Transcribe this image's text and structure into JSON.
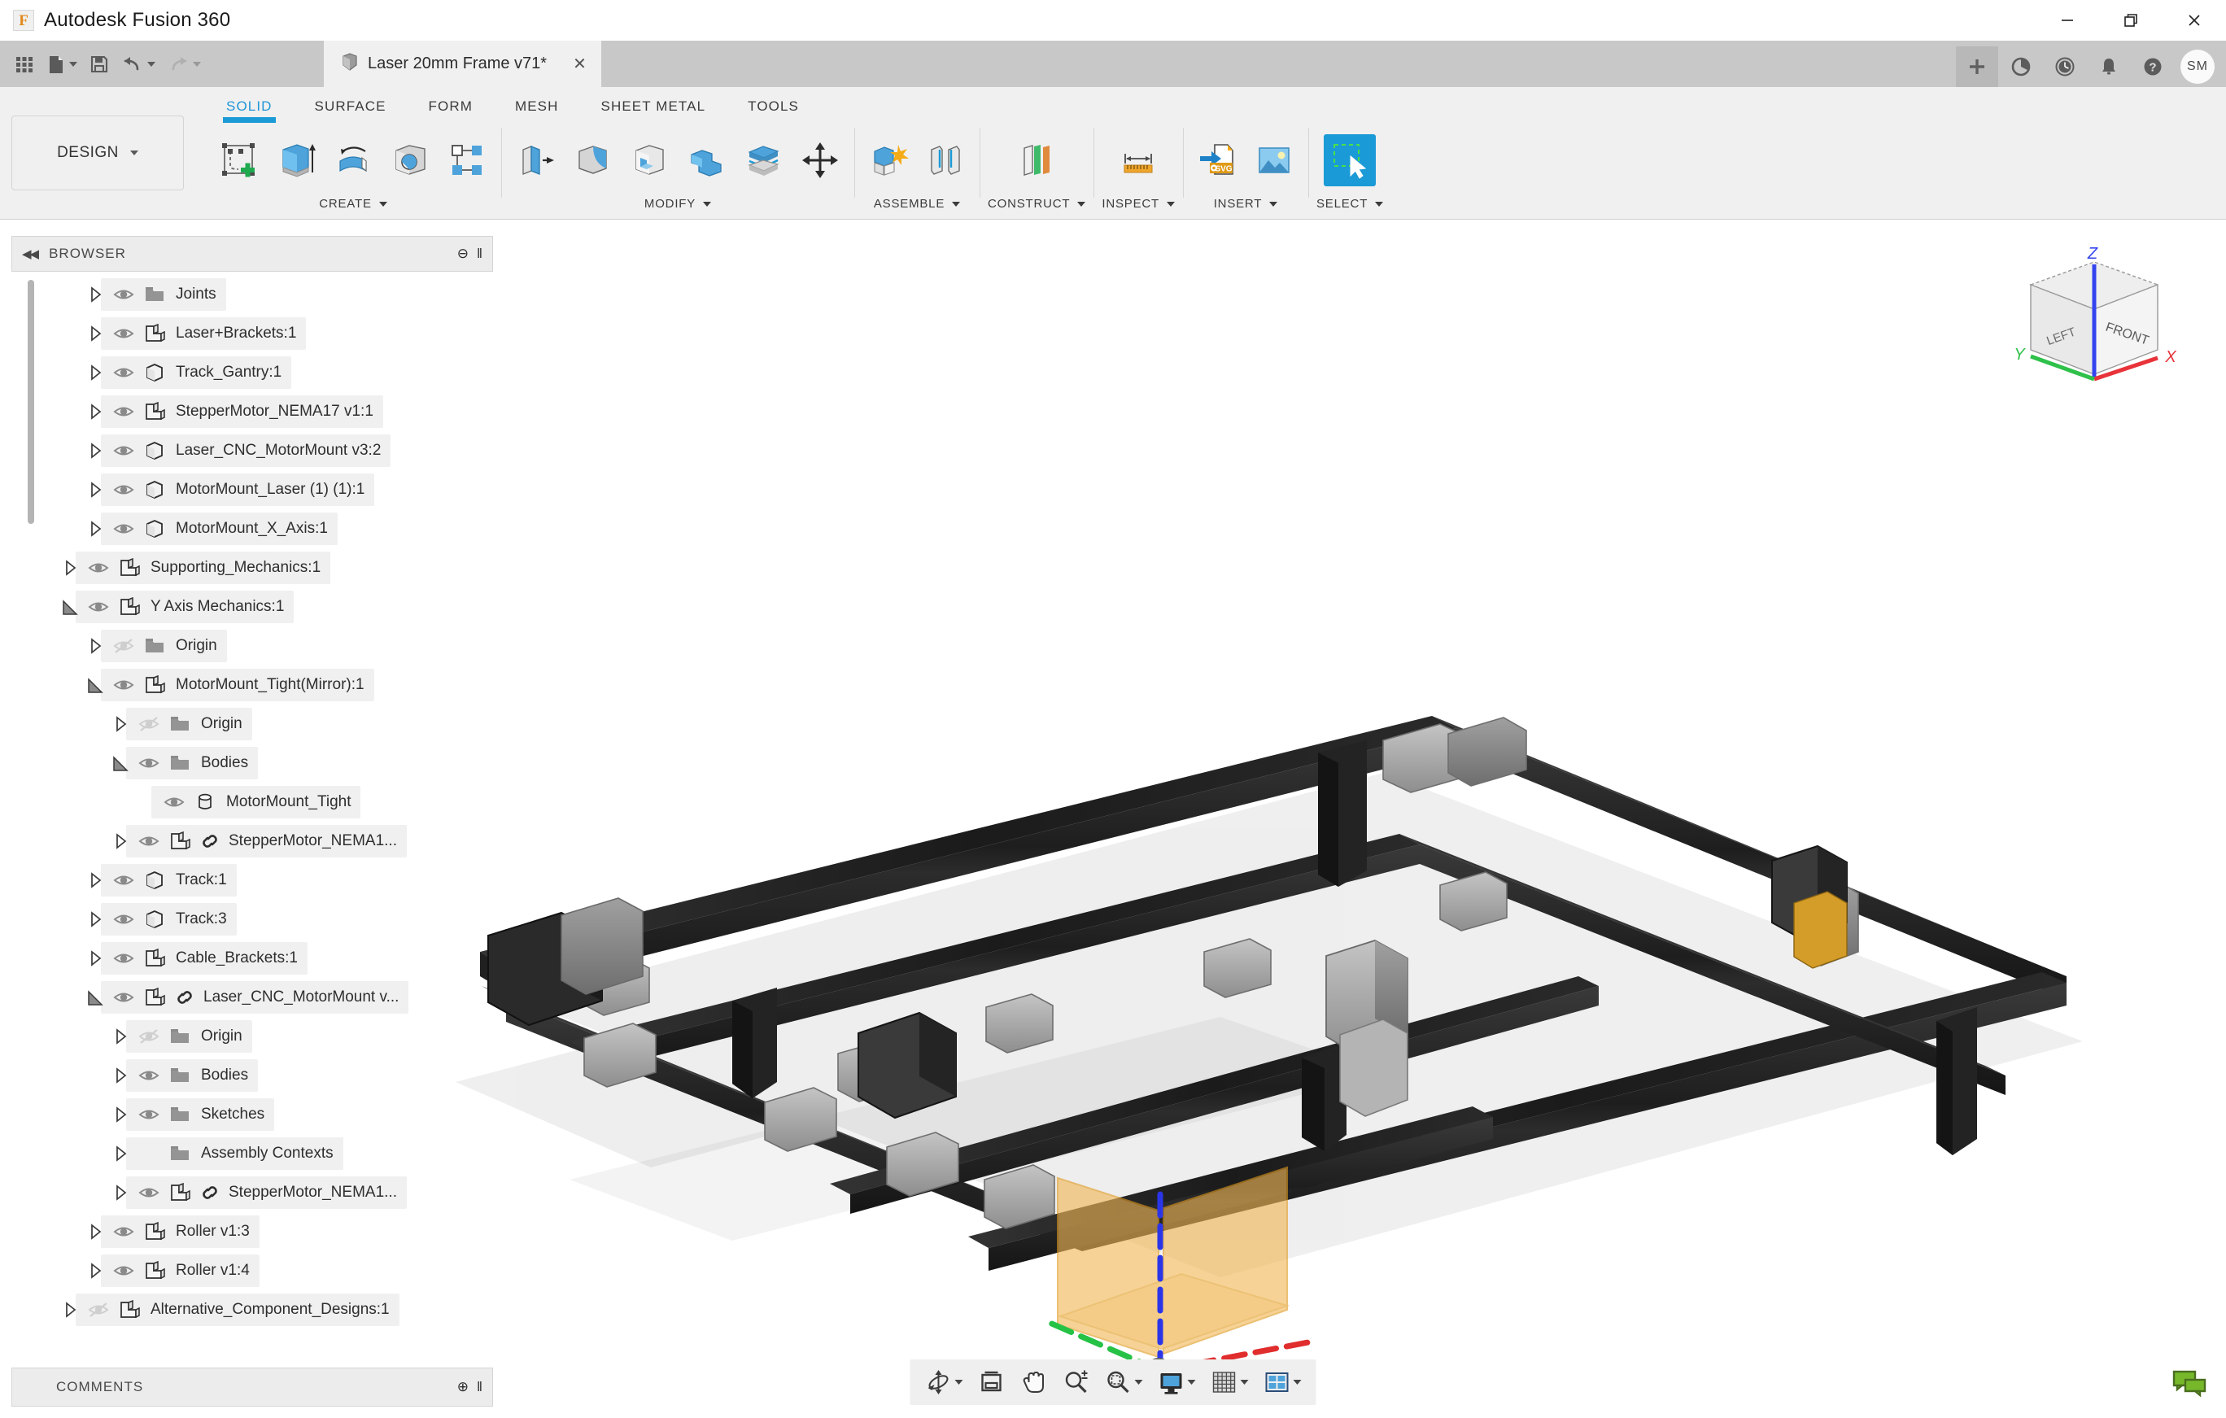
{
  "window": {
    "app_title": "Autodesk Fusion 360",
    "logo_glyph": "F",
    "minimize": "—",
    "restore": "❐",
    "close": "✕"
  },
  "quick_access": {
    "items": [
      {
        "name": "app-grid-icon",
        "label": "Grid"
      },
      {
        "name": "new-file-icon",
        "label": "New",
        "caret": true
      },
      {
        "name": "save-icon",
        "label": "Save"
      },
      {
        "name": "undo-icon",
        "label": "Undo",
        "caret": true
      },
      {
        "name": "redo-icon",
        "label": "Redo",
        "caret": true
      }
    ]
  },
  "document_tab": {
    "title": "Laser 20mm Frame v71*",
    "close_glyph": "✕",
    "icon": "component-icon"
  },
  "tab_actions": [
    {
      "name": "new-tab-button",
      "glyph": "+",
      "active": true
    },
    {
      "name": "extensions-icon",
      "glyph": "◔"
    },
    {
      "name": "recent-clock-icon",
      "glyph": "◴"
    },
    {
      "name": "notifications-bell-icon",
      "glyph": "▲"
    },
    {
      "name": "help-icon",
      "glyph": "?"
    }
  ],
  "user": {
    "initials": "SM"
  },
  "workspace": {
    "label": "DESIGN"
  },
  "ribbon": {
    "tabs": [
      {
        "label": "SOLID",
        "active": true
      },
      {
        "label": "SURFACE",
        "active": false
      },
      {
        "label": "FORM",
        "active": false
      },
      {
        "label": "MESH",
        "active": false
      },
      {
        "label": "SHEET METAL",
        "active": false
      },
      {
        "label": "TOOLS",
        "active": false
      }
    ],
    "groups": [
      {
        "label": "CREATE",
        "caret": true,
        "tools": [
          {
            "name": "create-sketch-icon"
          },
          {
            "name": "extrude-icon"
          },
          {
            "name": "revolve-icon"
          },
          {
            "name": "hole-icon"
          },
          {
            "name": "pattern-icon"
          }
        ]
      },
      {
        "label": "MODIFY",
        "caret": true,
        "tools": [
          {
            "name": "press-pull-icon"
          },
          {
            "name": "fillet-icon"
          },
          {
            "name": "shell-icon"
          },
          {
            "name": "combine-icon"
          },
          {
            "name": "offset-face-icon"
          },
          {
            "name": "move-copy-icon"
          }
        ]
      },
      {
        "label": "ASSEMBLE",
        "caret": true,
        "tools": [
          {
            "name": "new-component-icon"
          },
          {
            "name": "joint-icon"
          }
        ]
      },
      {
        "label": "CONSTRUCT",
        "caret": true,
        "tools": [
          {
            "name": "offset-plane-icon"
          }
        ]
      },
      {
        "label": "INSPECT",
        "caret": true,
        "tools": [
          {
            "name": "measure-icon"
          }
        ]
      },
      {
        "label": "INSERT",
        "caret": true,
        "tools": [
          {
            "name": "insert-svg-icon"
          },
          {
            "name": "insert-image-icon"
          }
        ]
      },
      {
        "label": "SELECT",
        "caret": true,
        "tools": [
          {
            "name": "select-window-icon",
            "selected": true
          }
        ]
      }
    ]
  },
  "browser": {
    "title": "BROWSER",
    "collapse_glyph": "◀◀",
    "settings_glyph": "⊖",
    "grip_glyph": "‖",
    "tree": [
      {
        "label": "Joints",
        "indent": 2,
        "arrow": "collapsed",
        "eye": "visible",
        "icon": "folder-icon",
        "link": false
      },
      {
        "label": "Laser+Brackets:1",
        "indent": 2,
        "arrow": "collapsed",
        "eye": "visible",
        "icon": "component-icon",
        "link": false
      },
      {
        "label": "Track_Gantry:1",
        "indent": 2,
        "arrow": "collapsed",
        "eye": "visible",
        "icon": "body-icon",
        "link": false
      },
      {
        "label": "StepperMotor_NEMA17 v1:1",
        "indent": 2,
        "arrow": "collapsed",
        "eye": "visible",
        "icon": "component-icon",
        "link": false
      },
      {
        "label": "Laser_CNC_MotorMount v3:2",
        "indent": 2,
        "arrow": "collapsed",
        "eye": "visible",
        "icon": "body-icon",
        "link": false
      },
      {
        "label": "MotorMount_Laser (1) (1):1",
        "indent": 2,
        "arrow": "collapsed",
        "eye": "visible",
        "icon": "body-icon",
        "link": false
      },
      {
        "label": "MotorMount_X_Axis:1",
        "indent": 2,
        "arrow": "collapsed",
        "eye": "visible",
        "icon": "body-icon",
        "link": false
      },
      {
        "label": "Supporting_Mechanics:1",
        "indent": 1,
        "arrow": "collapsed",
        "eye": "visible",
        "icon": "component-icon",
        "link": false
      },
      {
        "label": "Y Axis Mechanics:1",
        "indent": 1,
        "arrow": "expanded",
        "eye": "visible",
        "icon": "component-icon",
        "link": false
      },
      {
        "label": "Origin",
        "indent": 2,
        "arrow": "collapsed",
        "eye": "hidden",
        "icon": "folder-icon",
        "link": false
      },
      {
        "label": "MotorMount_Tight(Mirror):1",
        "indent": 2,
        "arrow": "expanded",
        "eye": "visible",
        "icon": "component-icon",
        "link": false
      },
      {
        "label": "Origin",
        "indent": 3,
        "arrow": "collapsed",
        "eye": "hidden",
        "icon": "folder-icon",
        "link": false
      },
      {
        "label": "Bodies",
        "indent": 3,
        "arrow": "expanded",
        "eye": "visible",
        "icon": "folder-icon",
        "link": false
      },
      {
        "label": "MotorMount_Tight",
        "indent": 4,
        "arrow": "none",
        "eye": "visible",
        "icon": "solid-body-icon",
        "link": false
      },
      {
        "label": "StepperMotor_NEMA1...",
        "indent": 3,
        "arrow": "collapsed",
        "eye": "visible",
        "icon": "component-icon",
        "link": true
      },
      {
        "label": "Track:1",
        "indent": 2,
        "arrow": "collapsed",
        "eye": "visible",
        "icon": "body-icon",
        "link": false
      },
      {
        "label": "Track:3",
        "indent": 2,
        "arrow": "collapsed",
        "eye": "visible",
        "icon": "body-icon",
        "link": false
      },
      {
        "label": "Cable_Brackets:1",
        "indent": 2,
        "arrow": "collapsed",
        "eye": "visible",
        "icon": "component-icon",
        "link": false
      },
      {
        "label": "Laser_CNC_MotorMount v...",
        "indent": 2,
        "arrow": "expanded",
        "eye": "visible",
        "icon": "component-icon",
        "link": true
      },
      {
        "label": "Origin",
        "indent": 3,
        "arrow": "collapsed",
        "eye": "hidden",
        "icon": "folder-icon",
        "link": false
      },
      {
        "label": "Bodies",
        "indent": 3,
        "arrow": "collapsed",
        "eye": "visible",
        "icon": "folder-icon",
        "link": false
      },
      {
        "label": "Sketches",
        "indent": 3,
        "arrow": "collapsed",
        "eye": "visible",
        "icon": "folder-icon",
        "link": false
      },
      {
        "label": "Assembly Contexts",
        "indent": 3,
        "arrow": "collapsed",
        "eye": "none",
        "icon": "folder-icon",
        "link": false
      },
      {
        "label": "StepperMotor_NEMA1...",
        "indent": 3,
        "arrow": "collapsed",
        "eye": "visible",
        "icon": "component-icon",
        "link": true
      },
      {
        "label": "Roller v1:3",
        "indent": 2,
        "arrow": "collapsed",
        "eye": "visible",
        "icon": "component-icon",
        "link": false
      },
      {
        "label": "Roller v1:4",
        "indent": 2,
        "arrow": "collapsed",
        "eye": "visible",
        "icon": "component-icon",
        "link": false
      },
      {
        "label": "Alternative_Component_Designs:1",
        "indent": 1,
        "arrow": "collapsed",
        "eye": "hidden",
        "icon": "component-icon",
        "link": false
      }
    ]
  },
  "comments": {
    "title": "COMMENTS",
    "add_glyph": "⊕",
    "grip_glyph": "‖"
  },
  "viewcube": {
    "front_face": "FRONT",
    "left_face": "LEFT",
    "axis_x": "X",
    "axis_y": "Y",
    "axis_z": "Z",
    "color_x": "#e8333a",
    "color_y": "#2fc14a",
    "color_z": "#3344ee"
  },
  "navbar": {
    "items": [
      {
        "name": "orbit-icon",
        "caret": true
      },
      {
        "name": "look-at-icon",
        "caret": false
      },
      {
        "name": "pan-icon",
        "caret": false
      },
      {
        "name": "zoom-icon",
        "caret": false
      },
      {
        "name": "fit-icon",
        "caret": true
      },
      {
        "name": "display-settings-icon",
        "caret": true
      },
      {
        "name": "grid-snaps-icon",
        "caret": true
      },
      {
        "name": "viewports-icon",
        "caret": true
      }
    ]
  },
  "status": {
    "chat_icon": "chat-bubble-icon",
    "chat_color": "#76b82a"
  },
  "canvas": {
    "model_name": "Laser 20mm Frame",
    "origin_plane_color": "#f5c77e",
    "extrusion_color": "#2a2a2a",
    "bracket_color": "#9a9a9a"
  }
}
